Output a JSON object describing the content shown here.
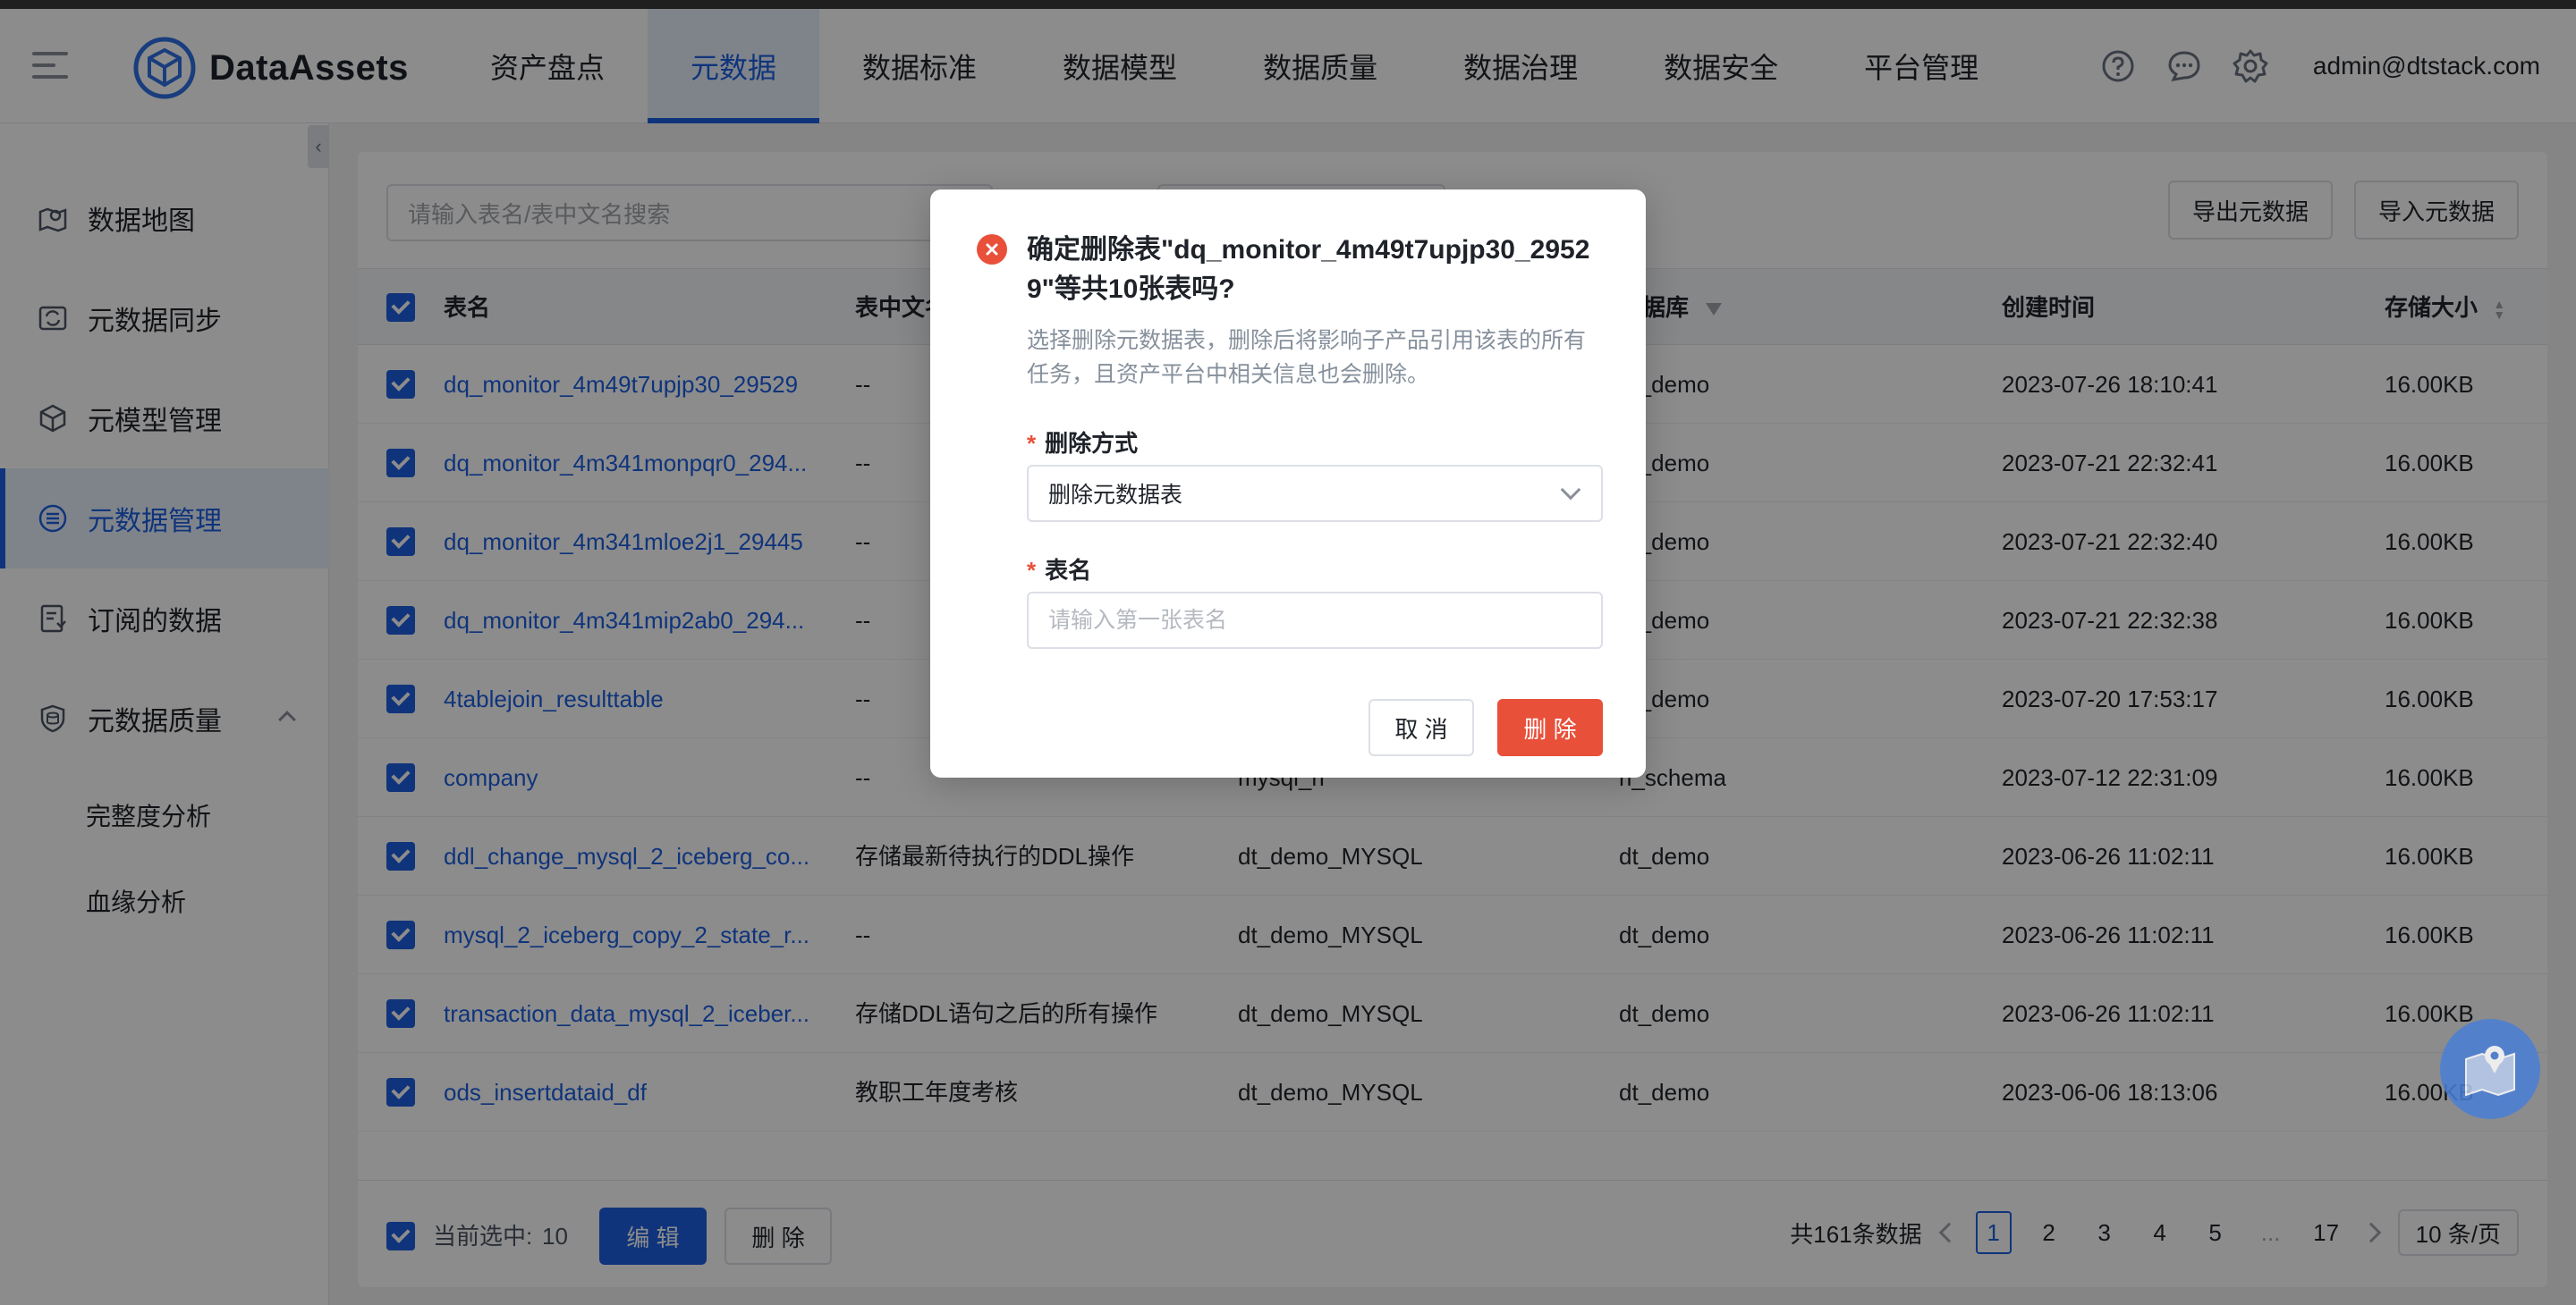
{
  "app": {
    "name": "DataAssets",
    "user": "admin@dtstack.com"
  },
  "nav": [
    "资产盘点",
    "元数据",
    "数据标准",
    "数据模型",
    "数据质量",
    "数据治理",
    "数据安全",
    "平台管理"
  ],
  "sidebar": {
    "items": [
      {
        "label": "数据地图",
        "icon": "map-icon"
      },
      {
        "label": "元数据同步",
        "icon": "sync-icon"
      },
      {
        "label": "元模型管理",
        "icon": "cube-icon"
      },
      {
        "label": "元数据管理",
        "icon": "stack-icon"
      },
      {
        "label": "订阅的数据",
        "icon": "subscribe-icon"
      },
      {
        "label": "元数据质量",
        "icon": "shield-db-icon"
      }
    ],
    "sub_items": [
      "完整度分析",
      "血缘分析"
    ]
  },
  "toolbar": {
    "search_placeholder": "请输入表名/表中文名搜索",
    "export_label": "导出元数据",
    "import_label": "导入元数据"
  },
  "table": {
    "headers": [
      "表名",
      "表中文名",
      "数据库",
      "创建时间",
      "存储大小"
    ],
    "rows": [
      {
        "name": "dq_monitor_4m49t7upjp30_29529",
        "cn": "--",
        "source": "",
        "db": "dt_demo",
        "time": "2023-07-26 18:10:41",
        "size": "16.00KB"
      },
      {
        "name": "dq_monitor_4m341monpqr0_294...",
        "cn": "--",
        "source": "",
        "db": "dt_demo",
        "time": "2023-07-21 22:32:41",
        "size": "16.00KB"
      },
      {
        "name": "dq_monitor_4m341mloe2j1_29445",
        "cn": "--",
        "source": "",
        "db": "dt_demo",
        "time": "2023-07-21 22:32:40",
        "size": "16.00KB"
      },
      {
        "name": "dq_monitor_4m341mip2ab0_294...",
        "cn": "--",
        "source": "",
        "db": "dt_demo",
        "time": "2023-07-21 22:32:38",
        "size": "16.00KB"
      },
      {
        "name": "4tablejoin_resulttable",
        "cn": "--",
        "source": "",
        "db": "dt_demo",
        "time": "2023-07-20 17:53:17",
        "size": "16.00KB"
      },
      {
        "name": "company",
        "cn": "--",
        "source": "mysql_rl",
        "db": "rl_schema",
        "time": "2023-07-12 22:31:09",
        "size": "16.00KB"
      },
      {
        "name": "ddl_change_mysql_2_iceberg_co...",
        "cn": "存储最新待执行的DDL操作",
        "source": "dt_demo_MYSQL",
        "db": "dt_demo",
        "time": "2023-06-26 11:02:11",
        "size": "16.00KB"
      },
      {
        "name": "mysql_2_iceberg_copy_2_state_r...",
        "cn": "--",
        "source": "dt_demo_MYSQL",
        "db": "dt_demo",
        "time": "2023-06-26 11:02:11",
        "size": "16.00KB"
      },
      {
        "name": "transaction_data_mysql_2_iceber...",
        "cn": "存储DDL语句之后的所有操作",
        "source": "dt_demo_MYSQL",
        "db": "dt_demo",
        "time": "2023-06-26 11:02:11",
        "size": "16.00KB"
      },
      {
        "name": "ods_insertdataid_df",
        "cn": "教职工年度考核",
        "source": "dt_demo_MYSQL",
        "db": "dt_demo",
        "time": "2023-06-06 18:13:06",
        "size": "16.00KB"
      }
    ]
  },
  "footer": {
    "selected_label": "当前选中:",
    "selected_count": "10",
    "edit_label": "编 辑",
    "delete_label": "删 除",
    "total": "共161条数据",
    "pages": [
      "1",
      "2",
      "3",
      "4",
      "5",
      "...",
      "17"
    ],
    "page_size": "10 条/页"
  },
  "modal": {
    "title": "确定删除表\"dq_monitor_4m49t7upjp30_29529\"等共10张表吗?",
    "description": "选择删除元数据表，删除后将影响子产品引用该表的所有任务，且资产平台中相关信息也会删除。",
    "method_label": "删除方式",
    "method_value": "删除元数据表",
    "name_label": "表名",
    "name_placeholder": "请输入第一张表名",
    "cancel_label": "取 消",
    "confirm_label": "删 除"
  },
  "colors": {
    "primary": "#1d5fe0",
    "danger": "#e8503a"
  }
}
